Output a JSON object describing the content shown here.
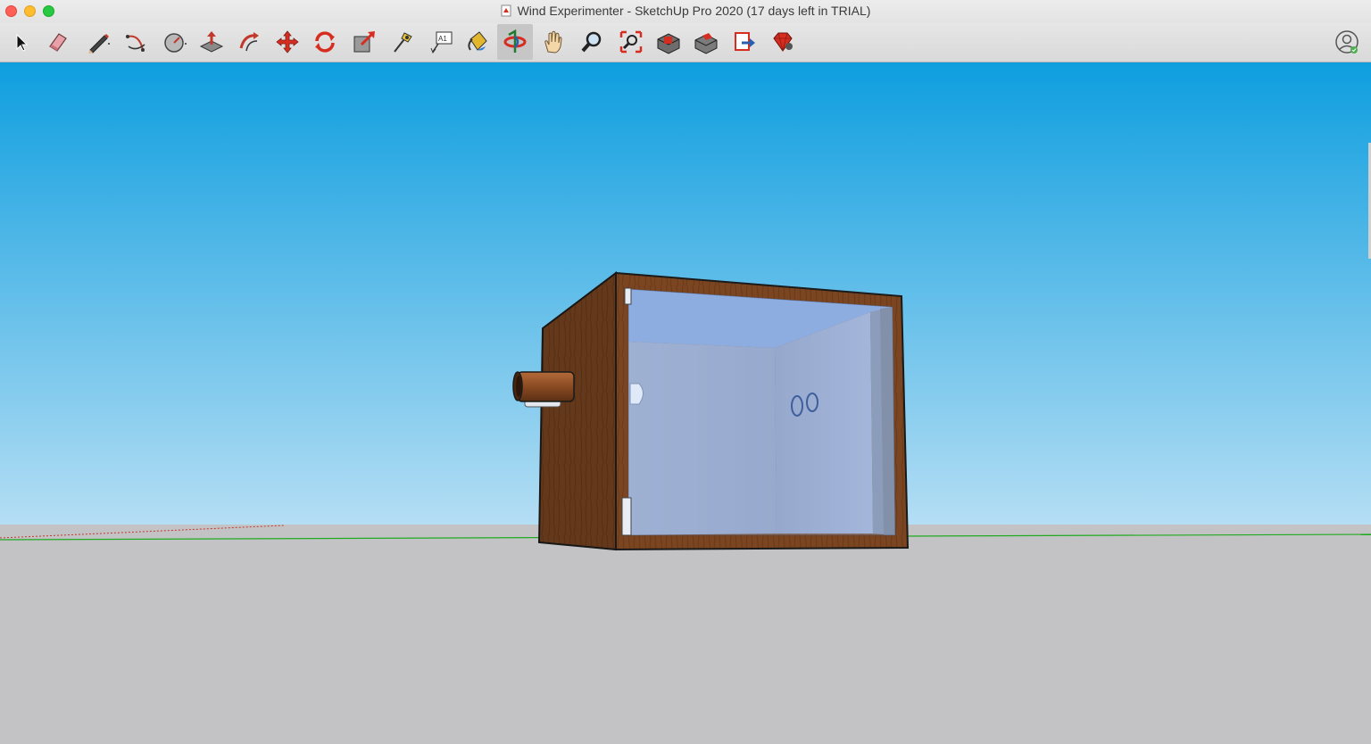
{
  "window": {
    "title": "Wind Experimenter - SketchUp Pro 2020 (17 days left in TRIAL)"
  },
  "toolbar": {
    "tools": [
      {
        "name": "select-tool",
        "icon": "arrow-cursor-icon"
      },
      {
        "name": "eraser-tool",
        "icon": "eraser-icon"
      },
      {
        "name": "line-tool",
        "icon": "pencil-icon"
      },
      {
        "name": "arc-tool",
        "icon": "arc-icon"
      },
      {
        "name": "shapes-tool",
        "icon": "circle-shape-icon"
      },
      {
        "name": "push-pull-tool",
        "icon": "push-pull-icon"
      },
      {
        "name": "offset-tool",
        "icon": "offset-icon"
      },
      {
        "name": "move-tool",
        "icon": "move-arrows-icon"
      },
      {
        "name": "rotate-tool",
        "icon": "rotate-icon"
      },
      {
        "name": "scale-tool",
        "icon": "scale-icon"
      },
      {
        "name": "tape-measure-tool",
        "icon": "tape-measure-icon"
      },
      {
        "name": "text-tool",
        "icon": "text-label-icon",
        "label": "A1"
      },
      {
        "name": "paint-bucket-tool",
        "icon": "paint-bucket-icon"
      },
      {
        "name": "orbit-tool",
        "icon": "orbit-icon",
        "active": true
      },
      {
        "name": "pan-tool",
        "icon": "hand-icon"
      },
      {
        "name": "zoom-tool",
        "icon": "magnifier-icon"
      },
      {
        "name": "zoom-extents-tool",
        "icon": "zoom-extents-icon"
      },
      {
        "name": "3d-warehouse-tool",
        "icon": "warehouse-icon"
      },
      {
        "name": "extension-warehouse-tool",
        "icon": "extension-warehouse-icon"
      },
      {
        "name": "send-to-layout-tool",
        "icon": "layout-icon"
      },
      {
        "name": "extension-manager-tool",
        "icon": "ruby-gem-icon"
      }
    ],
    "account": {
      "icon": "user-account-icon"
    }
  },
  "colors": {
    "sky_top": "#0e9edf",
    "sky_bottom": "#b5def4",
    "ground": "#c3c3c6",
    "wood": "#7a4520",
    "glass": "#a9c6ef",
    "green_axis": "#1faa1f",
    "red_axis": "#c0392b"
  }
}
